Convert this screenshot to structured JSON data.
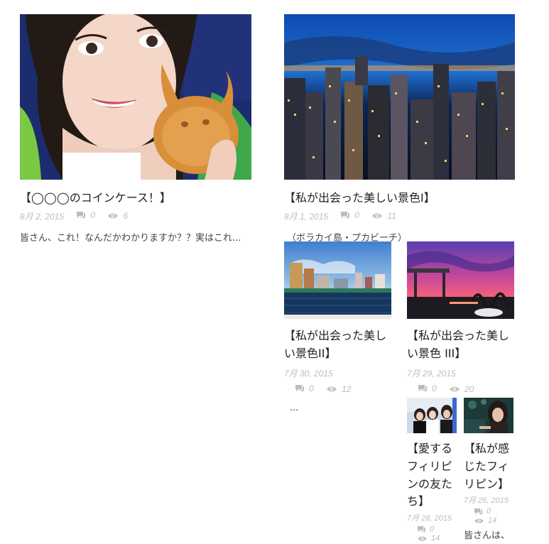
{
  "colors": {
    "meta": "#bcbcbc",
    "title": "#222222",
    "excerpt": "#444444"
  },
  "posts": [
    {
      "title": "【◯◯◯のコインケース！】",
      "date": "8月 2, 2015",
      "comments": "0",
      "views": "6",
      "excerpt": "皆さん、これ！なんだかわかりますか？？実はこれ..."
    },
    {
      "title": "【私が出会った美しい景色Ⅰ】",
      "date": "8月 1, 2015",
      "comments": "0",
      "views": "11",
      "excerpt": "（ボラカイ島・プカビーチ）"
    },
    {
      "title": "【私が出会った美しい景色II】",
      "date": "7月 30, 2015",
      "comments": "0",
      "views": "12",
      "excerpt": "..."
    },
    {
      "title": "【私が出会った美しい景色 III】",
      "date": "7月 29, 2015",
      "comments": "0",
      "views": "20",
      "excerpt": ""
    },
    {
      "title": "【愛するフィリピンの友たち】",
      "date": "7月 28, 2015",
      "comments": "0",
      "views": "14",
      "excerpt": ""
    },
    {
      "title": "【私が感じたフィリピン】",
      "date": "7月 26, 2015",
      "comments": "0",
      "views": "14",
      "excerpt": "皆さんは、"
    }
  ]
}
